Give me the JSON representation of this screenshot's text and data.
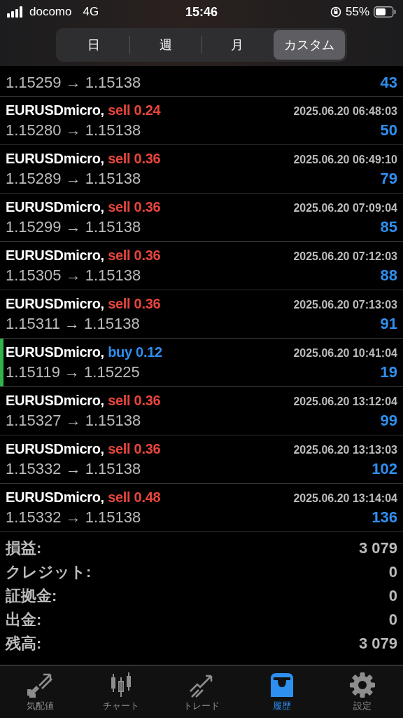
{
  "status_bar": {
    "carrier": "docomo",
    "network": "4G",
    "time": "15:46",
    "battery": "55%"
  },
  "period_tabs": [
    {
      "label": "日",
      "selected": false
    },
    {
      "label": "週",
      "selected": false
    },
    {
      "label": "月",
      "selected": false
    },
    {
      "label": "カスタム",
      "selected": true
    }
  ],
  "deals": [
    {
      "prices": "1.15259 → 1.15138",
      "profit": "43",
      "marked": false
    },
    {
      "symbol": "EURUSDmicro,",
      "kind": "sell",
      "type": "sell 0.24",
      "time": "2025.06.20 06:48:03",
      "prices": "1.15280 → 1.15138",
      "profit": "50",
      "marked": false
    },
    {
      "symbol": "EURUSDmicro,",
      "kind": "sell",
      "type": "sell 0.36",
      "time": "2025.06.20 06:49:10",
      "prices": "1.15289 → 1.15138",
      "profit": "79",
      "marked": false
    },
    {
      "symbol": "EURUSDmicro,",
      "kind": "sell",
      "type": "sell 0.36",
      "time": "2025.06.20 07:09:04",
      "prices": "1.15299 → 1.15138",
      "profit": "85",
      "marked": false
    },
    {
      "symbol": "EURUSDmicro,",
      "kind": "sell",
      "type": "sell 0.36",
      "time": "2025.06.20 07:12:03",
      "prices": "1.15305 → 1.15138",
      "profit": "88",
      "marked": false
    },
    {
      "symbol": "EURUSDmicro,",
      "kind": "sell",
      "type": "sell 0.36",
      "time": "2025.06.20 07:13:03",
      "prices": "1.15311 → 1.15138",
      "profit": "91",
      "marked": false
    },
    {
      "symbol": "EURUSDmicro,",
      "kind": "buy",
      "type": "buy 0.12",
      "time": "2025.06.20 10:41:04",
      "prices": "1.15119 → 1.15225",
      "profit": "19",
      "marked": true
    },
    {
      "symbol": "EURUSDmicro,",
      "kind": "sell",
      "type": "sell 0.36",
      "time": "2025.06.20 13:12:04",
      "prices": "1.15327 → 1.15138",
      "profit": "99",
      "marked": false
    },
    {
      "symbol": "EURUSDmicro,",
      "kind": "sell",
      "type": "sell 0.36",
      "time": "2025.06.20 13:13:03",
      "prices": "1.15332 → 1.15138",
      "profit": "102",
      "marked": false
    },
    {
      "symbol": "EURUSDmicro,",
      "kind": "sell",
      "type": "sell 0.48",
      "time": "2025.06.20 13:14:04",
      "prices": "1.15332 → 1.15138",
      "profit": "136",
      "marked": false
    }
  ],
  "summary": [
    {
      "label": "損益:",
      "value": "3 079"
    },
    {
      "label": "クレジット:",
      "value": "0"
    },
    {
      "label": "証拠金:",
      "value": "0"
    },
    {
      "label": "出金:",
      "value": "0"
    },
    {
      "label": "残高:",
      "value": "3 079"
    }
  ],
  "bottom_nav": [
    {
      "kind": "quotes",
      "label": "気配値",
      "selected": false
    },
    {
      "kind": "chart",
      "label": "チャート",
      "selected": false
    },
    {
      "kind": "trade",
      "label": "トレード",
      "selected": false
    },
    {
      "kind": "history",
      "label": "履歴",
      "selected": true
    },
    {
      "kind": "settings",
      "label": "設定",
      "selected": false
    }
  ]
}
